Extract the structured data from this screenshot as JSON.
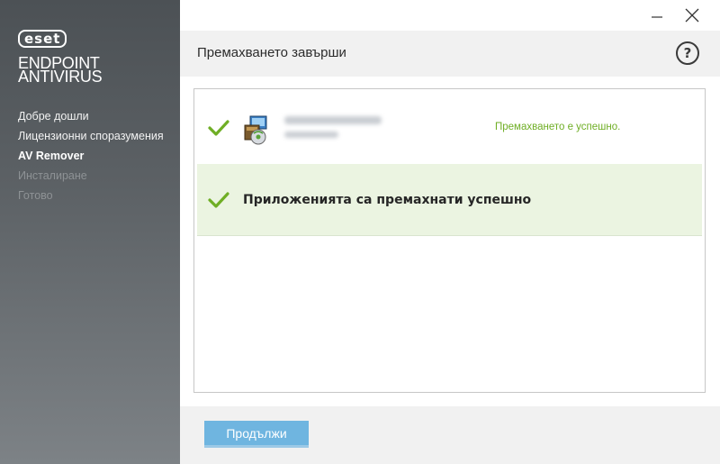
{
  "brand": {
    "logo_text": "eset",
    "product_line1": "ENDPOINT",
    "product_line2": "ANTIVIRUS"
  },
  "sidebar": {
    "items": [
      {
        "label": "Добре дошли",
        "state": "done"
      },
      {
        "label": "Лицензионни споразумения",
        "state": "done"
      },
      {
        "label": "AV Remover",
        "state": "active"
      },
      {
        "label": "Инсталиране",
        "state": "pending"
      },
      {
        "label": "Готово",
        "state": "pending"
      }
    ]
  },
  "window": {
    "minimize_icon": "minimize-icon",
    "close_icon": "close-icon"
  },
  "header": {
    "title": "Премахването завърши",
    "help_label": "?"
  },
  "results": {
    "item": {
      "status": "Премахването е успешно.",
      "icon": "installer-package-icon"
    },
    "summary": "Приложенията са премахнати успешно"
  },
  "footer": {
    "continue_label": "Продължи"
  },
  "colors": {
    "success_green": "#6fae25",
    "summary_bg": "#ebf4e1",
    "button_blue": "#6fb5e0",
    "sidebar_top": "#4c5155",
    "sidebar_bottom": "#7d8286"
  }
}
